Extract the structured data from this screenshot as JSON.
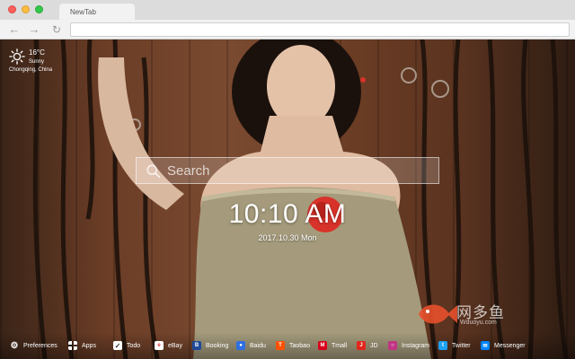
{
  "browser": {
    "tab_title": "NewTab",
    "url": ""
  },
  "weather": {
    "icon": "sun-icon",
    "temperature": "16°C",
    "condition": "Sunny",
    "location": "Chongqing, China"
  },
  "search": {
    "placeholder": "Search"
  },
  "clock": {
    "time": "10:10 AM",
    "date": "2017.10.30 Mon"
  },
  "bottom_bar": {
    "preferences_label": "Preferences",
    "apps_label": "Apps",
    "todo_label": "Todo",
    "shortcuts": [
      {
        "label": "eBay",
        "icon": "ebay-icon",
        "color": "#ffffff"
      },
      {
        "label": "Booking",
        "icon": "booking-icon",
        "color": "#1e4a9a"
      },
      {
        "label": "Baidu",
        "icon": "baidu-icon",
        "color": "#2f6fe0"
      },
      {
        "label": "Taobao",
        "icon": "taobao-icon",
        "color": "#ff5000"
      },
      {
        "label": "Tmall",
        "icon": "tmall-icon",
        "color": "#d8001a"
      },
      {
        "label": "JD",
        "icon": "jd-icon",
        "color": "#e1251b"
      },
      {
        "label": "Instagram",
        "icon": "instagram-icon",
        "color": "#c13584"
      },
      {
        "label": "Twitter",
        "icon": "twitter-icon",
        "color": "#1da1f2"
      },
      {
        "label": "Messenger",
        "icon": "messenger-icon",
        "color": "#0084ff"
      }
    ]
  },
  "watermark": {
    "text": "网多鱼",
    "sub": "Wduoyu.com"
  }
}
